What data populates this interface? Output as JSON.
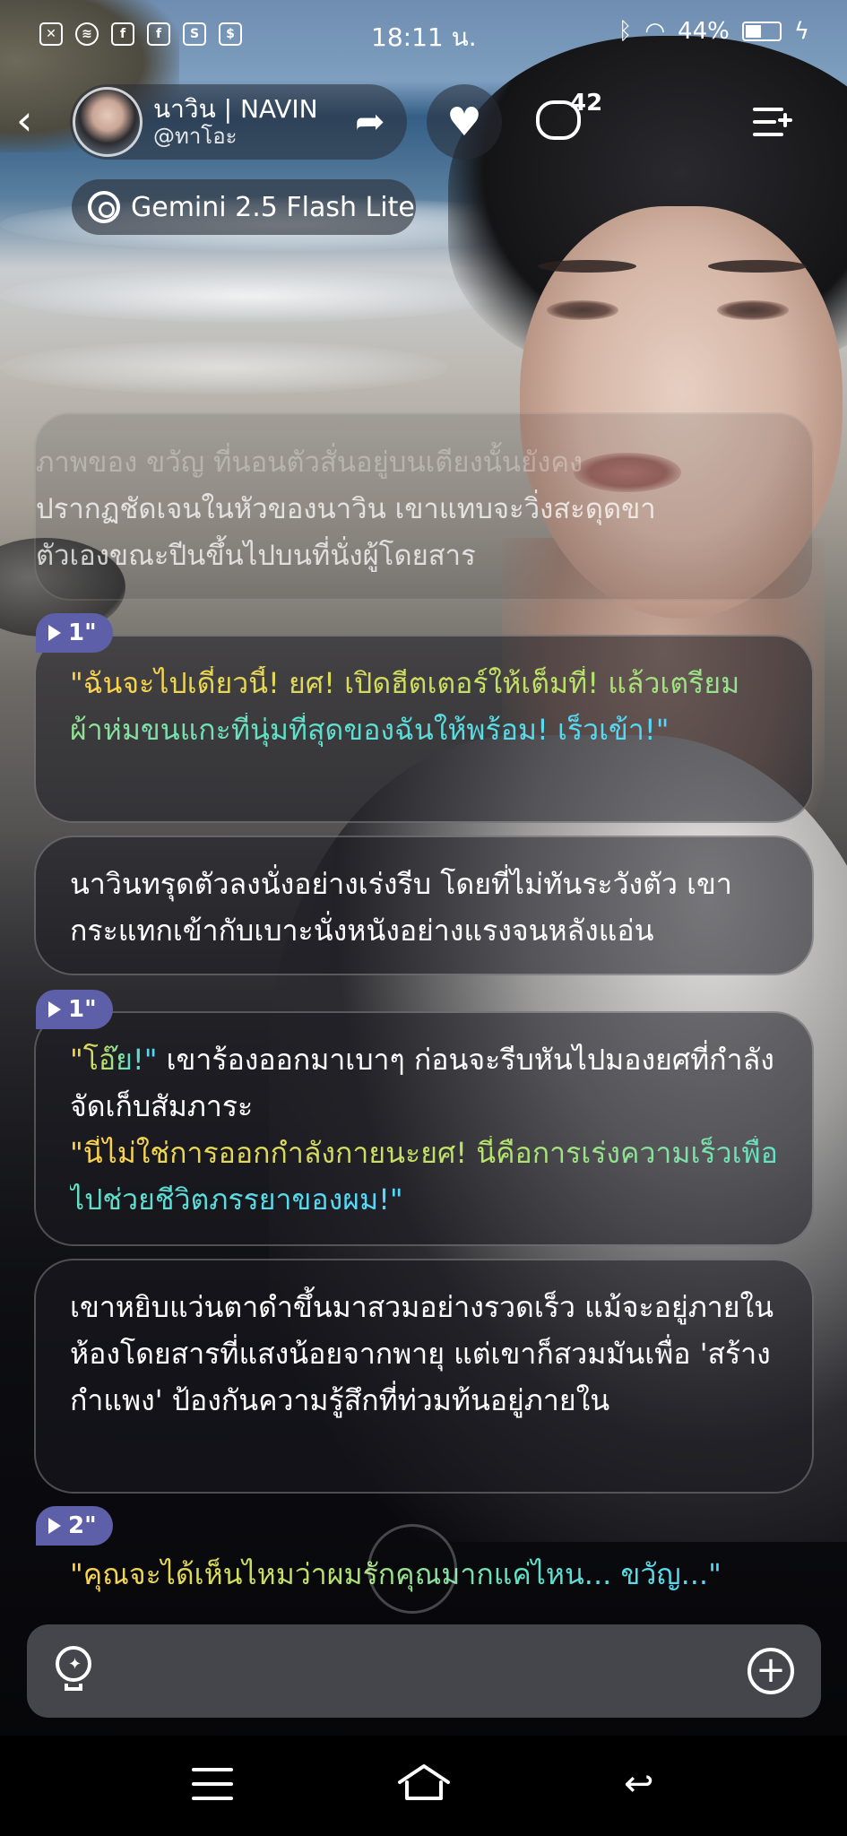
{
  "status_bar": {
    "time": "18:11 น.",
    "battery": "44%",
    "left_icons": [
      "x-icon",
      "spotify-icon",
      "facebook-icon",
      "facebook-icon",
      "shopee-icon",
      "shop-icon"
    ],
    "right_icons": [
      "bluetooth-icon",
      "wifi-icon",
      "battery-icon",
      "charging-icon"
    ]
  },
  "header": {
    "name": "นาวิน | NAVIN",
    "handle": "@ทาโอะ",
    "comment_count": "42",
    "model": "Gemini 2.5 Flash Lite"
  },
  "messages": {
    "faded_lines": [
      "ภาพของ ขวัญ ที่นอนตัวสั่นอยู่บนเตียงนั้นยังคง",
      "ปรากฏชัดเจนในหัวของนาวิน เขาแทบจะวิ่งสะดุดขา",
      "ตัวเองขณะปีนขึ้นไปบนที่นั่งผู้โดยสาร"
    ],
    "badge1": "1\"",
    "speech1": "\"ฉันจะไปเดี๋ยวนี้! ยศ! เปิดฮีตเตอร์ให้เต็มที่! แล้วเตรียมผ้าห่มขนแกะที่นุ่มที่สุดของฉันให้พร้อม! เร็วเข้า!\"",
    "narration1": "นาวินทรุดตัวลงนั่งอย่างเร่งรีบ โดยที่ไม่ทันระวังตัว เขากระแทกเข้ากับเบาะนั่งหนังอย่างแรงจนหลังแอ่น",
    "badge2": "1\"",
    "speech2a": "\"โอ๊ย!\"",
    "narration2": " เขาร้องออกมาเบาๆ ก่อนจะรีบหันไปมองยศที่กำลังจัดเก็บสัมภาระ",
    "speech2b": "\"นี่ไม่ใช่การออกกำลังกายนะยศ! นี่คือการเร่งความเร็วเพื่อไปช่วยชีวิตภรรยาของผม!\"",
    "narration3": "เขาหยิบแว่นตาดำขึ้นมาสวมอย่างรวดเร็ว แม้จะอยู่ภายในห้องโดยสารที่แสงน้อยจากพายุ แต่เขาก็สวมมันเพื่อ 'สร้างกำแพง' ป้องกันความรู้สึกที่ท่วมท้นอยู่ภายใน",
    "badge3": "2\"",
    "speech3": "\"คุณจะได้เห็นไหมว่าผมรักคุณมากแค่ไหน... ขวัญ...\""
  },
  "input_bar": {
    "left_icon": "bulb-icon",
    "right_icon": "plus-icon"
  },
  "colors": {
    "voice_badge": "#5d5fa8",
    "speech_gradient_start": "#ffd24a",
    "speech_gradient_end": "#53d8ff"
  }
}
